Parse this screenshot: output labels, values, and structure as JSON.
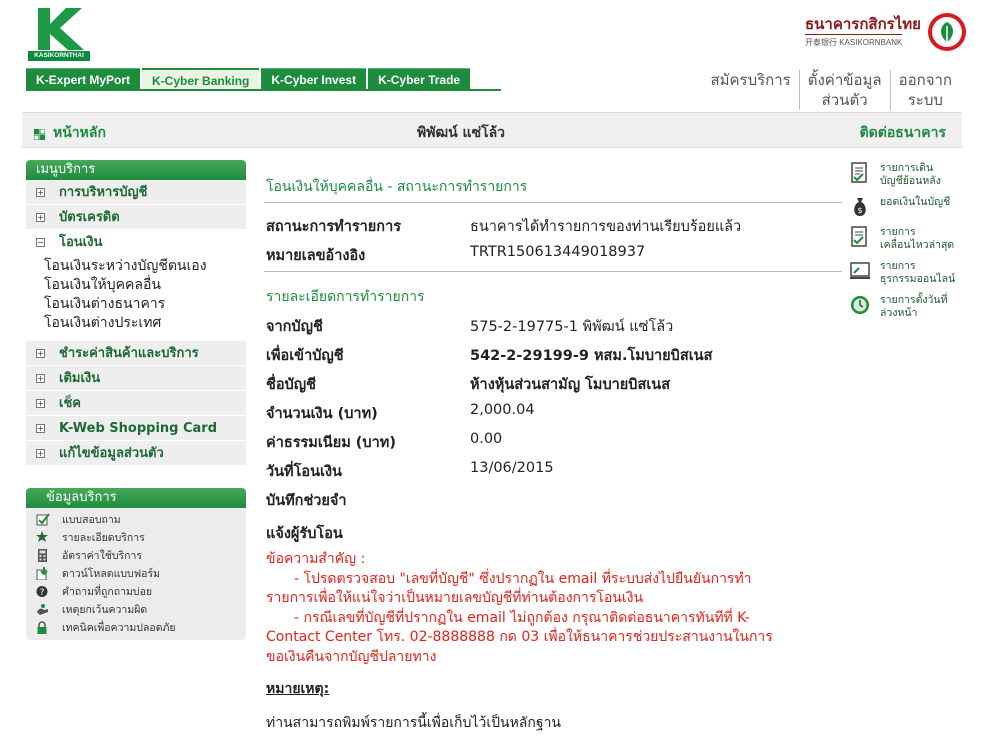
{
  "brand": {
    "left_caption": "KASIKORNTHAI",
    "right_thai": "ธนาคารกสิกรไทย",
    "right_eng": "开泰银行 KASIKORNBANK",
    "accent": "#1d8c3d",
    "alert_color": "#e2231a"
  },
  "tabs": [
    {
      "label": "K-Expert MyPort"
    },
    {
      "label": "K-Cyber Banking"
    },
    {
      "label": "K-Cyber Invest"
    },
    {
      "label": "K-Cyber Trade"
    }
  ],
  "toplinks": {
    "register": "สมัครบริการ",
    "settings_1": "ตั้งค่าข้อมูล",
    "settings_2": "ส่วนตัว",
    "logout_1": "ออกจาก",
    "logout_2": "ระบบ"
  },
  "bar": {
    "home": "หน้าหลัก",
    "username": "พิพัฒน์ แซ่โล้ว",
    "contact": "ติดต่อธนาคาร"
  },
  "sidebar": {
    "header": "เมนูบริการ",
    "items_top": [
      {
        "label": "การบริหารบัญชี",
        "icon": "plus-icon"
      },
      {
        "label": "บัตรเครดิต",
        "icon": "plus-icon"
      },
      {
        "label": "โอนเงิน",
        "icon": "minus-icon"
      }
    ],
    "sub_items": [
      "โอนเงินระหว่างบัญชีตนเอง",
      "โอนเงินให้บุคคลอื่น",
      "โอนเงินต่างธนาคาร",
      "โอนเงินต่างประเทศ"
    ],
    "items_bottom": [
      {
        "label": "ชำระค่าสินค้าและบริการ",
        "icon": "plus-icon"
      },
      {
        "label": "เติมเงิน",
        "icon": "plus-icon"
      },
      {
        "label": "เช็ค",
        "icon": "plus-icon"
      },
      {
        "label": "K-Web Shopping Card",
        "icon": "plus-icon"
      },
      {
        "label": "แก้ไขข้อมูลส่วนตัว",
        "icon": "plus-icon"
      }
    ]
  },
  "info": {
    "header": "ข้อมูลบริการ",
    "items": [
      {
        "label": "แบบสอบถาม",
        "icon": "checkbox-icon"
      },
      {
        "label": "รายละเอียดบริการ",
        "icon": "star-icon"
      },
      {
        "label": "อัตราค่าใช้บริการ",
        "icon": "calculator-icon"
      },
      {
        "label": "ดาวน์โหลดแบบฟอร์ม",
        "icon": "download-icon"
      },
      {
        "label": "คำถามที่ถูกถามบ่อย",
        "icon": "question-icon"
      },
      {
        "label": "เหตุยกเว้นความผิด",
        "icon": "hand-icon"
      },
      {
        "label": "เทคนิคเพื่อความปลอดภัย",
        "icon": "lock-icon"
      }
    ]
  },
  "main": {
    "title": "โอนเงินให้บุคคลอื่น - สถานะการทำรายการ",
    "status_label": "สถานะการทำรายการ",
    "status_value": "ธนาคารได้ทำรายการของท่านเรียบร้อยแล้ว",
    "ref_label": "หมายเลขอ้างอิง",
    "ref_value": "TRTR150613449018937",
    "details_title": "รายละเอียดการทำรายการ",
    "from_label": "จากบัญชี",
    "from_value": "575-2-19775-1 พิพัฒน์ แซ่โล้ว",
    "to_label": "เพื่อเข้าบัญชี",
    "to_value": "542-2-29199-9 หสม.โมบายบิสเนส",
    "name_label": "ชื่อบัญชี",
    "name_value": "ห้างหุ้นส่วนสามัญ โมบายบิสเนส",
    "amount_label": "จำนวนเงิน (บาท)",
    "amount_value": "2,000.04",
    "fee_label": "ค่าธรรมเนียม (บาท)",
    "fee_value": "0.00",
    "date_label": "วันที่โอนเงิน",
    "date_value": "13/06/2015",
    "memo_label": "บันทึกช่วยจำ",
    "notify_label": "แจ้งผู้รับโอน",
    "notice_title": "ข้อความสำคัญ :",
    "notice_1a": "- โปรดตรวจสอบ \"เลขที่บัญชี\" ซึ่งปรากฏใน email ที่ระบบส่งไปยืนยันการทำ",
    "notice_1b": "รายการเพื่อให้แน่ใจว่าเป็นหมายเลขบัญชีที่ท่านต้องการโอนเงิน",
    "notice_2a": "- กรณีเลขที่บัญชีที่ปรากฏใน email ไม่ถูกต้อง กรุณาติดต่อธนาคารทันทีที่ K-",
    "notice_2b": "Contact Center โทร. 02-8888888 กด 03 เพื่อให้ธนาคารช่วยประสานงานในการ",
    "notice_2c": "ขอเงินคืนจากบัญชีปลายทาง",
    "remark_title": "หมายเหตุ:",
    "remark_text": "ท่านสามารถพิมพ์รายการนี้เพื่อเก็บไว้เป็นหลักฐาน"
  },
  "quick": [
    {
      "l1": "รายการเดิน",
      "l2": "บัญชีย้อนหลัง",
      "icon": "statement-icon"
    },
    {
      "l1": "ยอดเงินในบัญชี",
      "l2": "",
      "icon": "moneybag-icon"
    },
    {
      "l1": "รายการ",
      "l2": "เคลื่อนไหวล่าสุด",
      "icon": "recent-icon"
    },
    {
      "l1": "รายการ",
      "l2": "ธุรกรรมออนไลน์",
      "icon": "online-icon"
    },
    {
      "l1": "รายการตั้งวันที่",
      "l2": "ล่วงหน้า",
      "icon": "clock-icon"
    }
  ]
}
